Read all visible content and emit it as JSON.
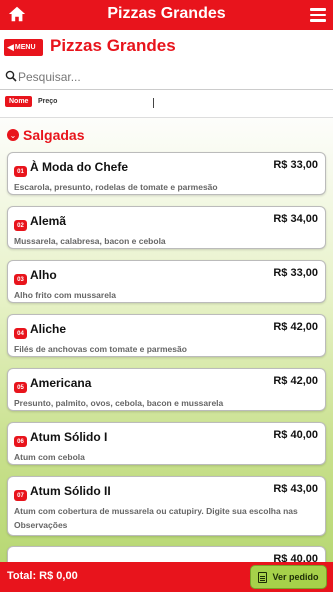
{
  "topbar": {
    "title": "Pizzas Grandes"
  },
  "header": {
    "back_label": "MENU",
    "page_title": "Pizzas Grandes"
  },
  "search": {
    "placeholder": "Pesquisar..."
  },
  "sort": {
    "nome": "Nome",
    "preco": "Preço"
  },
  "section": {
    "label": "Salgadas"
  },
  "items": [
    {
      "num": "01",
      "name": "À Moda do Chefe",
      "price": "R$ 33,00",
      "desc": "Escarola, presunto, rodelas de tomate e parmesão"
    },
    {
      "num": "02",
      "name": "Alemã",
      "price": "R$ 34,00",
      "desc": "Mussarela, calabresa, bacon e cebola"
    },
    {
      "num": "03",
      "name": "Alho",
      "price": "R$ 33,00",
      "desc": "Alho frito com mussarela"
    },
    {
      "num": "04",
      "name": "Aliche",
      "price": "R$ 42,00",
      "desc": "Filés de anchovas com tomate e parmesão"
    },
    {
      "num": "05",
      "name": "Americana",
      "price": "R$ 42,00",
      "desc": "Presunto, palmito, ovos, cebola, bacon e mussarela"
    },
    {
      "num": "06",
      "name": "Atum Sólido I",
      "price": "R$ 40,00",
      "desc": "Atum com cebola"
    },
    {
      "num": "07",
      "name": "Atum Sólido II",
      "price": "R$ 43,00",
      "desc": "Atum com cobertura de mussarela ou catupiry. Digite sua escolha nas Observações"
    },
    {
      "num": "",
      "name": "",
      "price": "R$ 40,00",
      "desc": ""
    }
  ],
  "footer": {
    "total": "Total: R$ 0,00",
    "order_label": "Ver pedido"
  },
  "colors": {
    "brand_red": "#e8141c",
    "order_green": "#a6d14a"
  }
}
